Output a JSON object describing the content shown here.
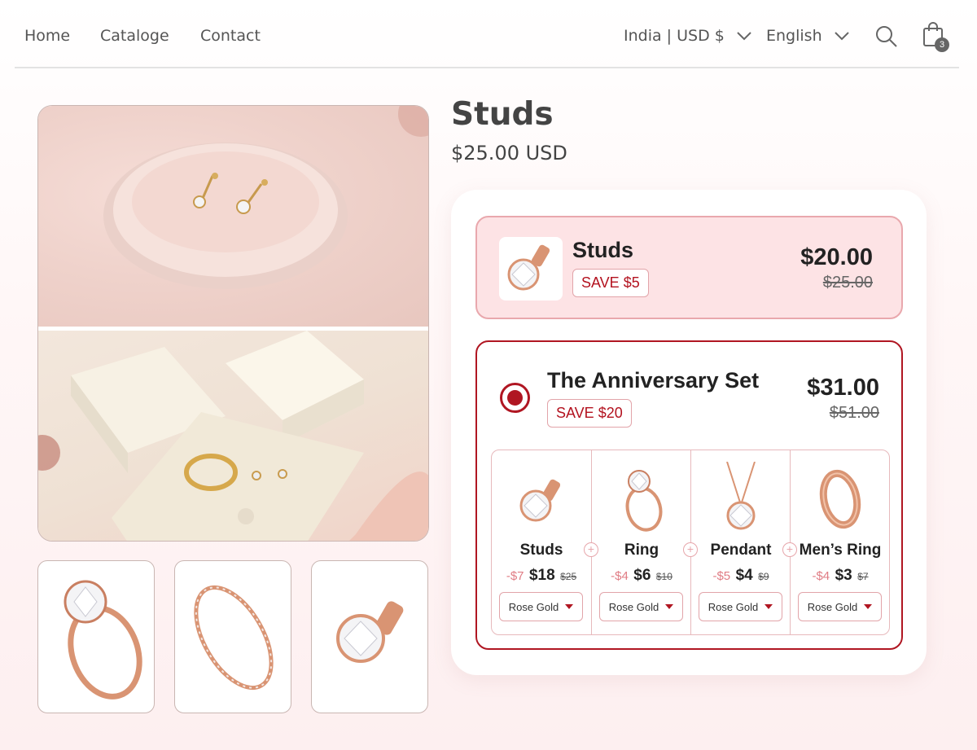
{
  "nav": {
    "links": [
      "Home",
      "Cataloge",
      "Contact"
    ],
    "region": "India | USD $",
    "language": "English",
    "cart_count": "3"
  },
  "product": {
    "title": "Studs",
    "price": "$25.00 USD"
  },
  "single_offer": {
    "name": "Studs",
    "save": "SAVE $5",
    "price": "$20.00",
    "compare_price": "$25.00"
  },
  "bundle_offer": {
    "name": "The Anniversary Set",
    "save": "SAVE $20",
    "price": "$31.00",
    "compare_price": "$51.00",
    "items": [
      {
        "name": "Studs",
        "discount": "-$7",
        "price": "$18",
        "was": "$25",
        "variant": "Rose Gold"
      },
      {
        "name": "Ring",
        "discount": "-$4",
        "price": "$6",
        "was": "$10",
        "variant": "Rose Gold"
      },
      {
        "name": "Pendant",
        "discount": "-$5",
        "price": "$4",
        "was": "$9",
        "variant": "Rose Gold"
      },
      {
        "name": "Men’s Ring",
        "discount": "-$4",
        "price": "$3",
        "was": "$7",
        "variant": "Rose Gold"
      }
    ]
  },
  "icons": {
    "search": "search-icon",
    "cart": "shopping-bag-icon",
    "plus": "plus-icon",
    "chevron": "chevron-down-icon",
    "caret": "caret-down-icon"
  },
  "colors": {
    "accent": "#b01622",
    "offer_bg": "#fde3e5",
    "text": "#222222"
  }
}
